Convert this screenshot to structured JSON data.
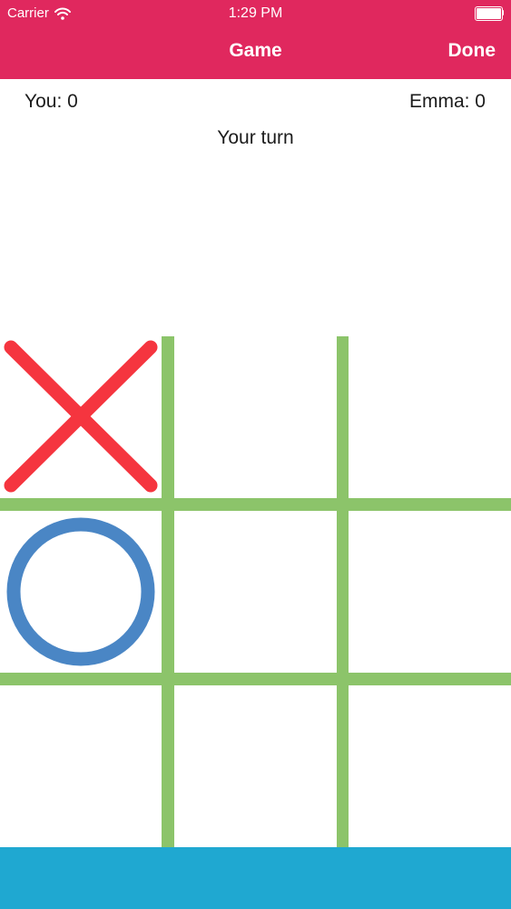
{
  "status_bar": {
    "carrier": "Carrier",
    "time": "1:29 PM",
    "wifi_icon": "wifi-icon",
    "battery_icon": "battery-icon",
    "battery_level": 1.0
  },
  "nav": {
    "title": "Game",
    "done_label": "Done"
  },
  "scores": {
    "you": "You: 0",
    "opponent": "Emma: 0"
  },
  "turn_status": "Your turn",
  "board": {
    "rows": 3,
    "cols": 3,
    "cells": [
      "X",
      "",
      "",
      "O",
      "",
      "",
      "",
      "",
      ""
    ]
  },
  "colors": {
    "header": "#e0285e",
    "grid": "#8cc46a",
    "x_mark": "#f5353f",
    "o_mark": "#4a86c5",
    "bottom_bar": "#1fa8d1",
    "text": "#1c1c1c"
  }
}
